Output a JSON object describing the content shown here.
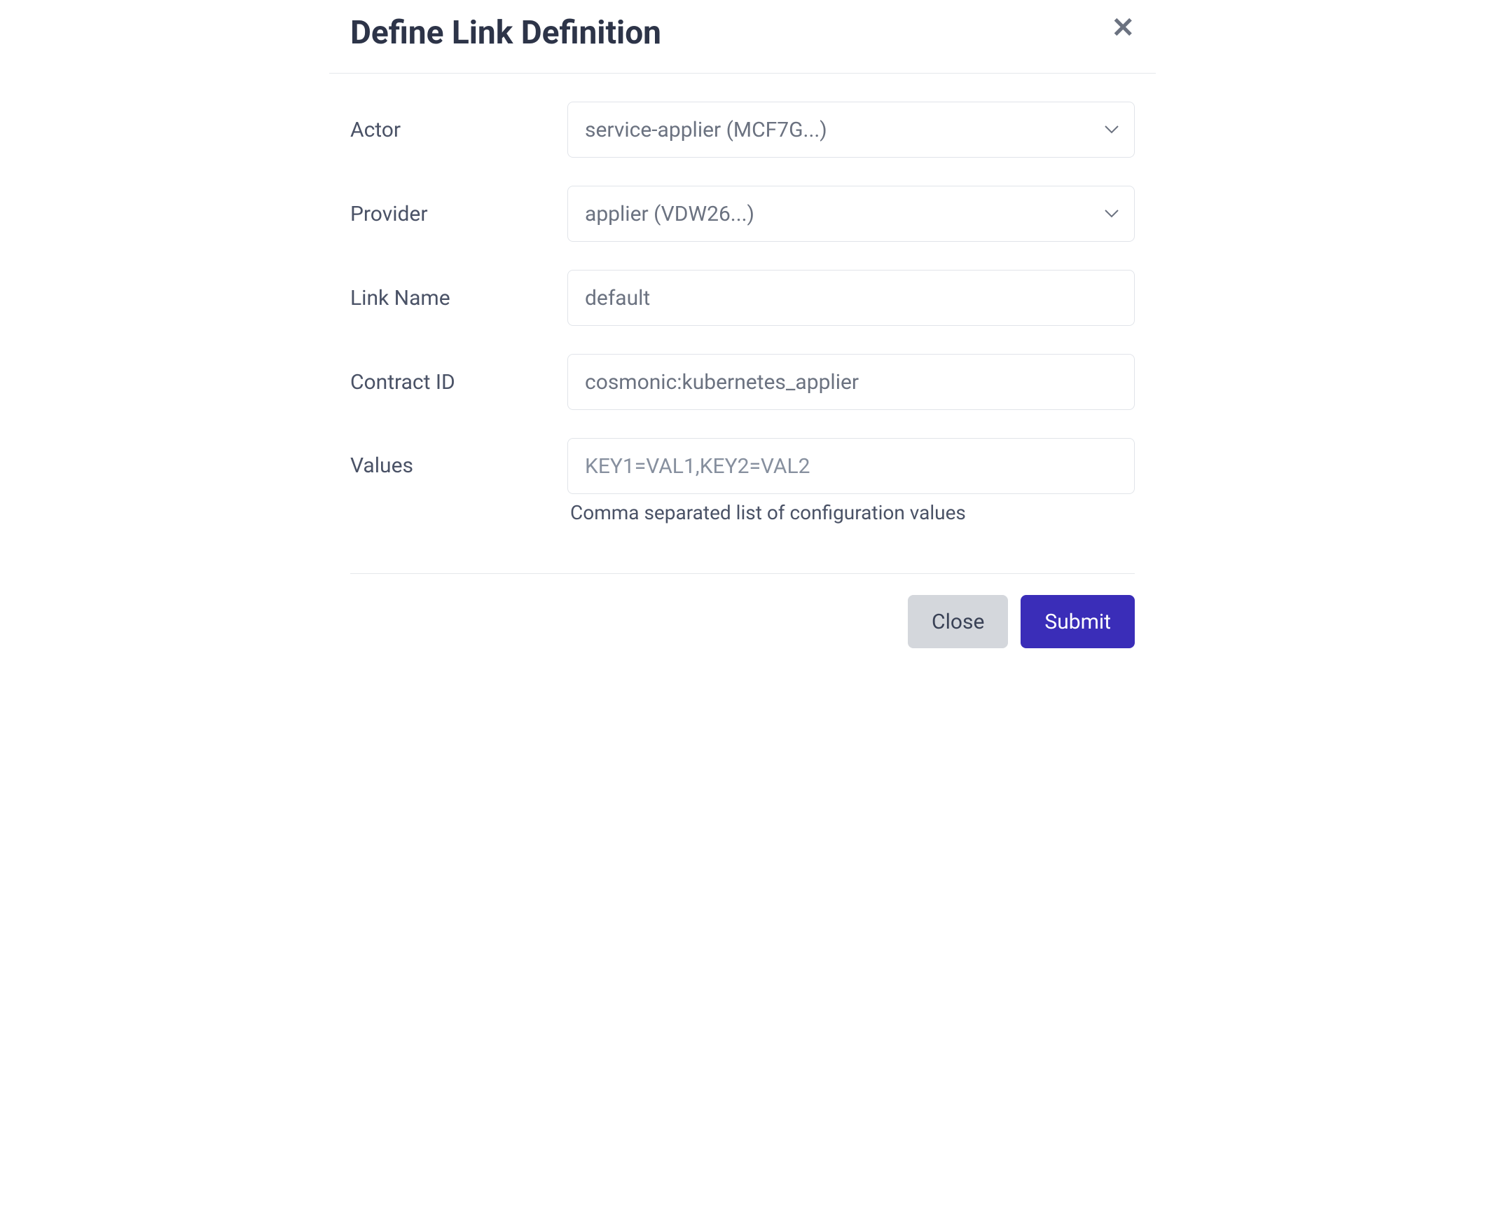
{
  "modal": {
    "title": "Define Link Definition"
  },
  "form": {
    "actor": {
      "label": "Actor",
      "value": "service-applier (MCF7G...)"
    },
    "provider": {
      "label": "Provider",
      "value": "applier (VDW26...)"
    },
    "link_name": {
      "label": "Link Name",
      "value": "default"
    },
    "contract_id": {
      "label": "Contract ID",
      "value": "cosmonic:kubernetes_applier"
    },
    "values": {
      "label": "Values",
      "value": "",
      "placeholder": "KEY1=VAL1,KEY2=VAL2",
      "help": "Comma separated list of configuration values"
    }
  },
  "footer": {
    "close_label": "Close",
    "submit_label": "Submit"
  }
}
